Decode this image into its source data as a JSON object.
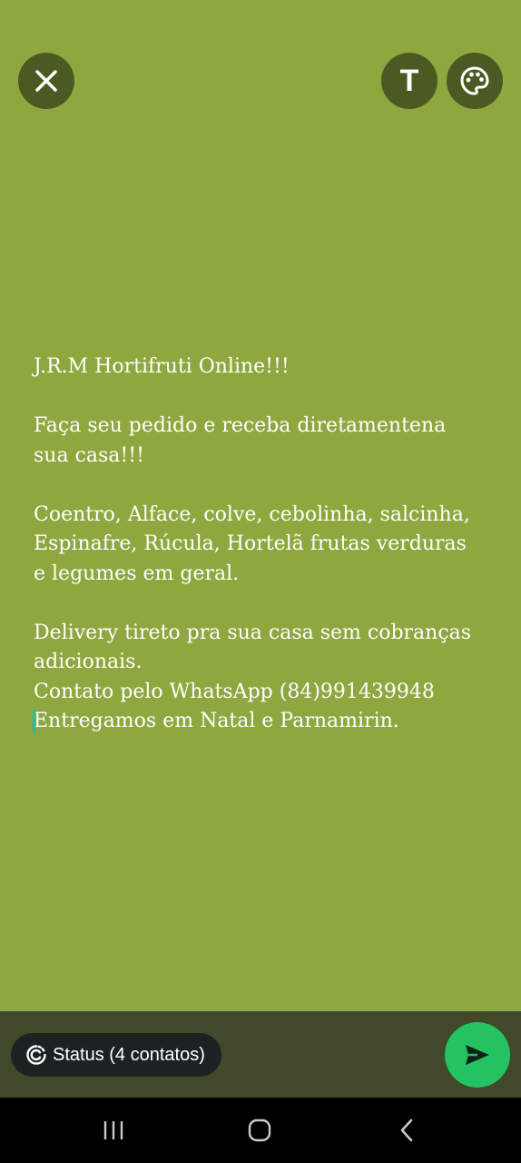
{
  "toolbar": {
    "close_icon": "close-icon",
    "text_button_label": "T",
    "palette_icon": "palette-icon"
  },
  "status": {
    "text": "J.R.M Hortifruti Online!!!\n\nFaça seu pedido e receba diretamentena\nsua casa!!!\n\nCoentro, Alface, colve, cebolinha, salcinha,\nEspinafre, Rúcula, Hortelã frutas verduras\ne legumes em geral.\n\nDelivery tireto pra sua casa sem cobranças\nadicionais.\nContato pelo WhatsApp (84)991439948\nEntregamos em Natal e Parnamirin.",
    "background_color": "#8ea83f"
  },
  "footer": {
    "audience_label": "Status (4 contatos)",
    "audience_icon": "status-privacy-icon",
    "send_icon": "send-icon",
    "send_color": "#25c262"
  },
  "nav": {
    "recents_icon": "recents-icon",
    "home_icon": "home-icon",
    "back_icon": "back-icon"
  }
}
